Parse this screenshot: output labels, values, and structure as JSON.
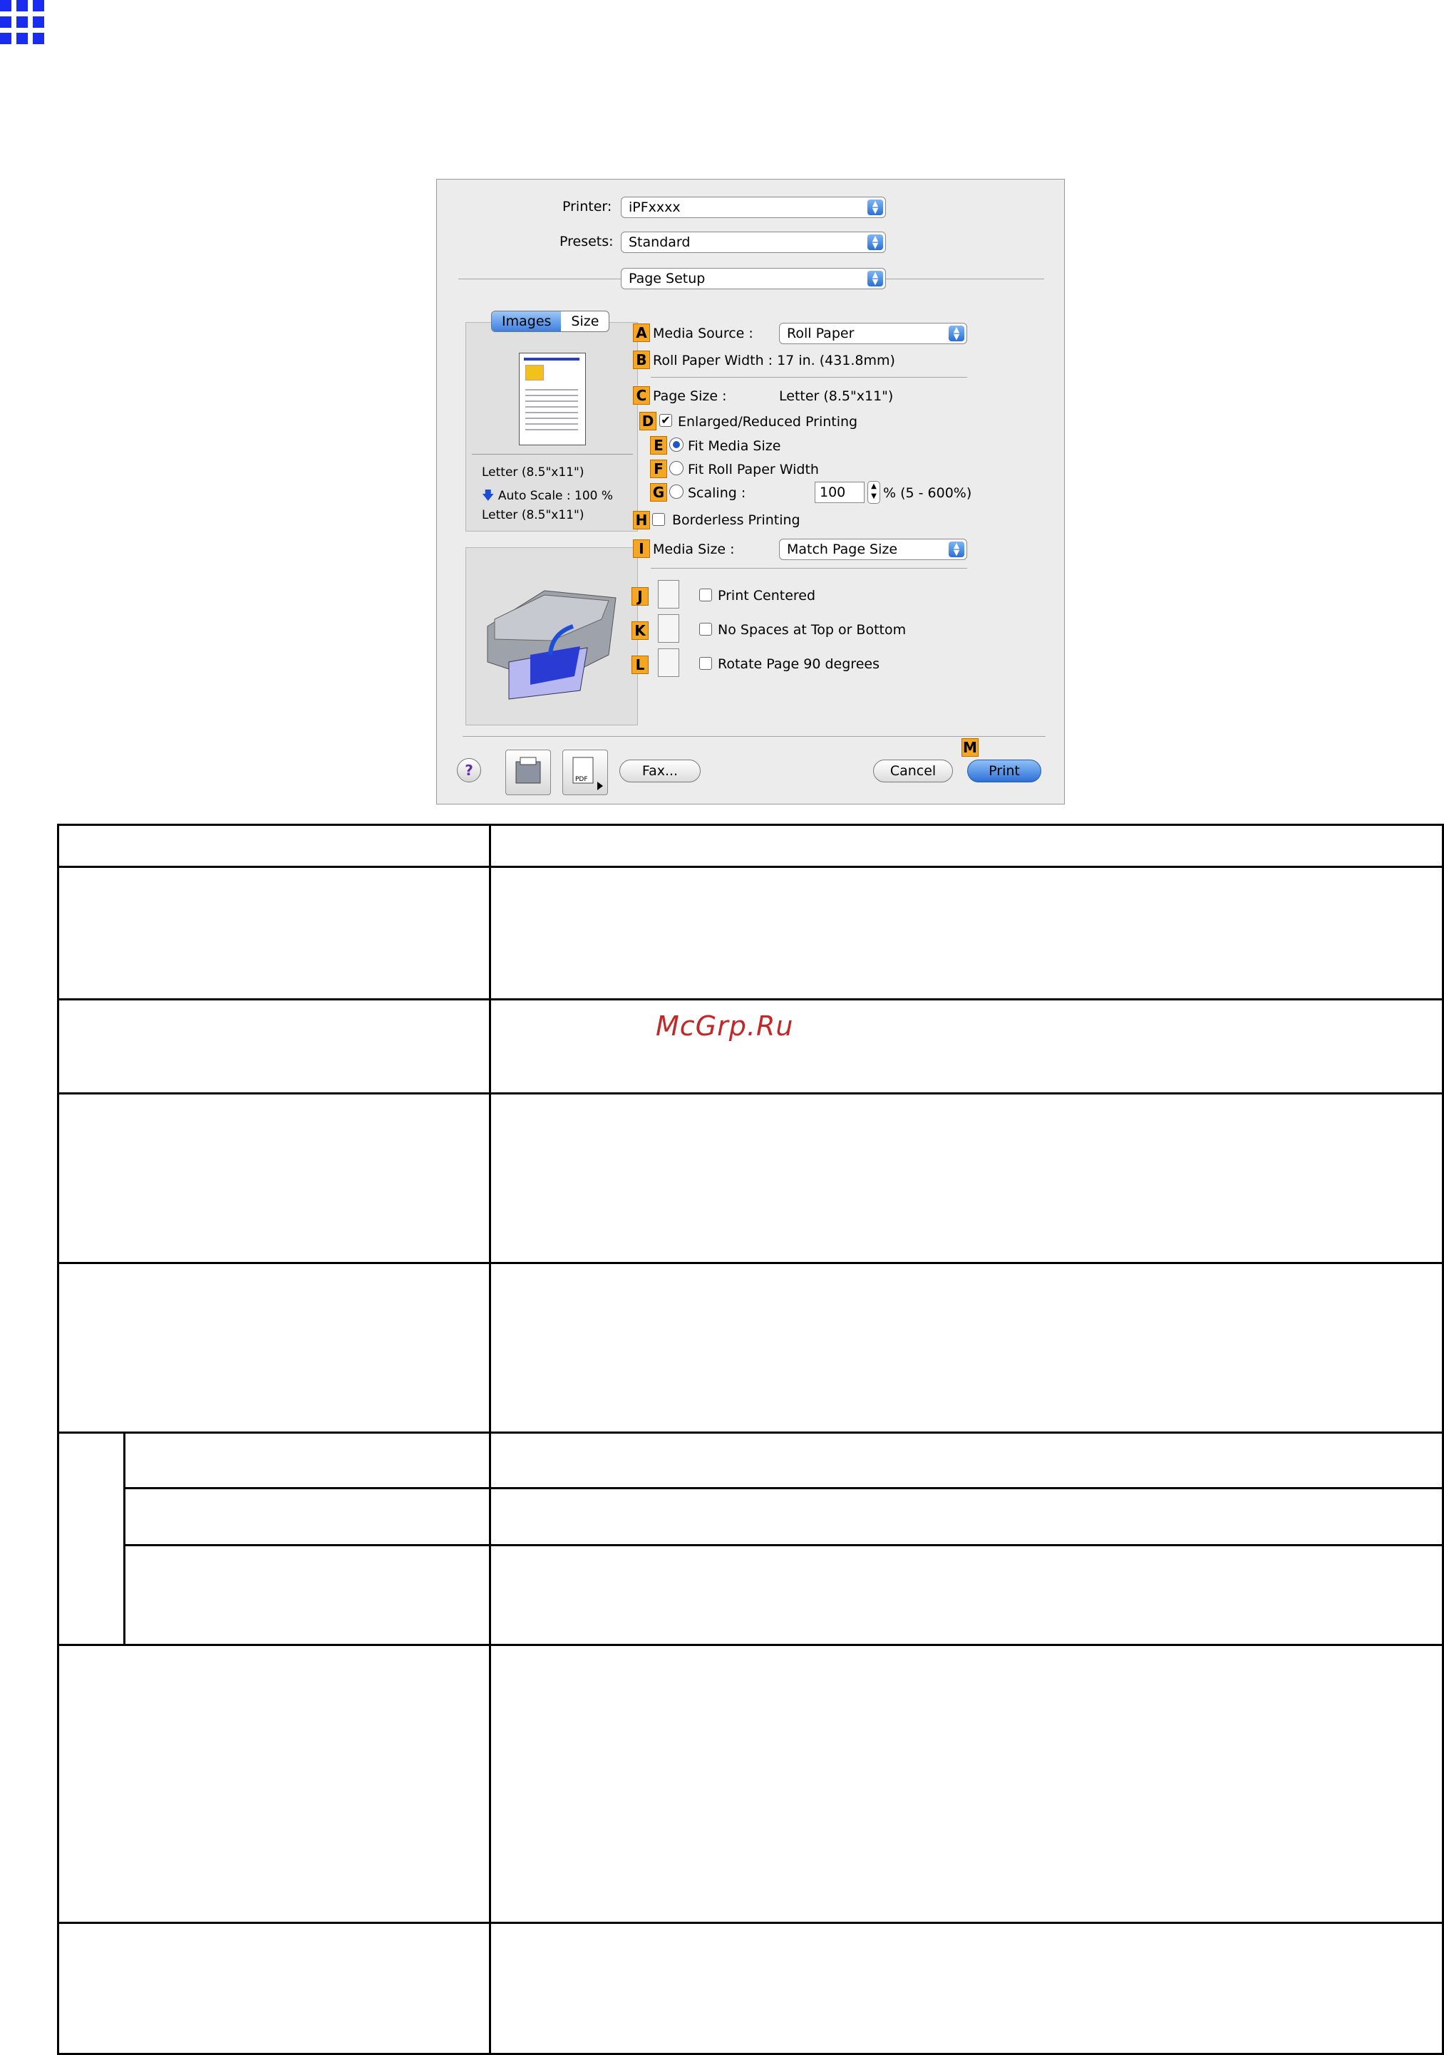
{
  "dialog": {
    "printer_label": "Printer:",
    "printer_value": "iPFxxxx",
    "presets_label": "Presets:",
    "presets_value": "Standard",
    "pane_value": "Page Setup",
    "tabs": [
      "Images",
      "Size"
    ],
    "preview_info": [
      "Letter (8.5\"x11\")",
      "Auto Scale : 100 %",
      "Letter (8.5\"x11\")"
    ],
    "markers": [
      "A",
      "B",
      "C",
      "D",
      "E",
      "F",
      "G",
      "H",
      "I",
      "J",
      "K",
      "L",
      "M"
    ],
    "media_source_label": "Media Source :",
    "media_source_value": "Roll Paper",
    "roll_paper_width": "Roll Paper Width : 17 in. (431.8mm)",
    "page_size_label": "Page Size :",
    "page_size_value": "Letter (8.5\"x11\")",
    "enlarged_reduced": "Enlarged/Reduced Printing",
    "fit_media_size": "Fit Media Size",
    "fit_roll_paper_width": "Fit Roll Paper Width",
    "scaling_label": "Scaling :",
    "scaling_value": "100",
    "scaling_range": "% (5 - 600%)",
    "borderless": "Borderless Printing",
    "media_size_label": "Media Size :",
    "media_size_value": "Match Page Size",
    "print_centered": "Print Centered",
    "no_spaces": "No Spaces at Top or Bottom",
    "rotate_page": "Rotate Page 90 degrees",
    "help": "?",
    "fax_button": "Fax...",
    "cancel_button": "Cancel",
    "print_button": "Print",
    "pdf_label": "PDF"
  },
  "watermark": "McGrp.Ru"
}
